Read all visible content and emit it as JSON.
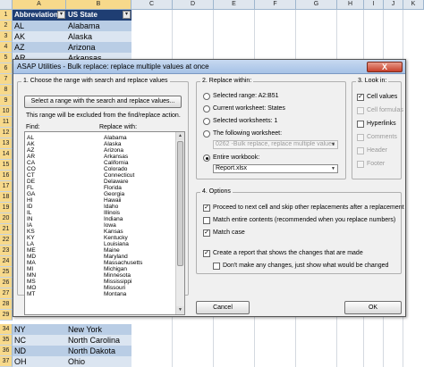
{
  "spreadsheet": {
    "columns": [
      "A",
      "B",
      "C",
      "D",
      "E",
      "F",
      "G",
      "H",
      "I",
      "J",
      "K"
    ],
    "selected_columns": [
      "A",
      "B"
    ],
    "header_row": {
      "a": "Abbreviation",
      "b": "US State"
    },
    "top_rows": [
      {
        "row": "1"
      },
      {
        "row": "2",
        "a": "AL",
        "b": "Alabama"
      },
      {
        "row": "3",
        "a": "AK",
        "b": "Alaska"
      },
      {
        "row": "4",
        "a": "AZ",
        "b": "Arizona"
      },
      {
        "row": "5",
        "a": "AR",
        "b": "Arkansas"
      }
    ],
    "hidden_rows": [
      "6",
      "7",
      "8",
      "9",
      "10",
      "11",
      "12",
      "13",
      "14",
      "15",
      "16",
      "17",
      "18",
      "19",
      "20",
      "21",
      "22",
      "23",
      "24",
      "25",
      "26",
      "27",
      "28",
      "29",
      "30",
      "31",
      "32",
      "33"
    ],
    "bottom_rows": [
      {
        "row": "34",
        "a": "NY",
        "b": "New York"
      },
      {
        "row": "35",
        "a": "NC",
        "b": "North Carolina"
      },
      {
        "row": "36",
        "a": "ND",
        "b": "North Dakota"
      },
      {
        "row": "37",
        "a": "OH",
        "b": "Ohio"
      }
    ],
    "filter_glyph": "▾"
  },
  "dialog": {
    "title": "ASAP Utilities - Bulk replace: replace multiple values at once",
    "close_glyph": "X",
    "group1": {
      "label": "1. Choose the range with search and replace values",
      "select_button": "Select a range with the search and replace values...",
      "note": "This range will be excluded from the find/replace action.",
      "find_header": "Find:",
      "replace_header": "Replace with:",
      "pairs": [
        [
          "AL",
          "Alabama"
        ],
        [
          "AK",
          "Alaska"
        ],
        [
          "AZ",
          "Arizona"
        ],
        [
          "AR",
          "Arkansas"
        ],
        [
          "CA",
          "California"
        ],
        [
          "CO",
          "Colorado"
        ],
        [
          "CT",
          "Connecticut"
        ],
        [
          "DE",
          "Delaware"
        ],
        [
          "FL",
          "Florida"
        ],
        [
          "GA",
          "Georgia"
        ],
        [
          "HI",
          "Hawaii"
        ],
        [
          "ID",
          "Idaho"
        ],
        [
          "IL",
          "Illinois"
        ],
        [
          "IN",
          "Indiana"
        ],
        [
          "IA",
          "Iowa"
        ],
        [
          "KS",
          "Kansas"
        ],
        [
          "KY",
          "Kentucky"
        ],
        [
          "LA",
          "Louisiana"
        ],
        [
          "ME",
          "Maine"
        ],
        [
          "MD",
          "Maryland"
        ],
        [
          "MA",
          "Massachusetts"
        ],
        [
          "MI",
          "Michigan"
        ],
        [
          "MN",
          "Minnesota"
        ],
        [
          "MS",
          "Mississippi"
        ],
        [
          "MO",
          "Missouri"
        ],
        [
          "MT",
          "Montana"
        ]
      ]
    },
    "group2": {
      "label": "2. Replace within:",
      "opt_selected_range": "Selected range: A2:B51",
      "opt_current_ws": "Current worksheet: States",
      "opt_selected_ws": "Selected worksheets: 1",
      "opt_following_ws": "The following worksheet:",
      "following_ws_value": "0262 -Bulk replace, replace multiple values",
      "opt_entire_workbook": "Entire workbook:",
      "workbook_value": "Report.xlsx"
    },
    "group3": {
      "label": "3. Look in:",
      "cell_values": "Cell values",
      "cell_formulas": "Cell formulas",
      "hyperlinks": "Hyperlinks",
      "comments": "Comments",
      "header": "Header",
      "footer": "Footer"
    },
    "group4": {
      "label": "4. Options",
      "proceed": "Proceed to next cell and skip other replacements after a replacement",
      "match_entire": "Match entire contents (recommended when you replace numbers)",
      "match_case": "Match case",
      "create_report": "Create a report that shows the changes that are made",
      "dont_make_changes": "Don't make any changes, just show what would be changed"
    },
    "cancel": "Cancel",
    "ok": "OK",
    "check_glyph": "✓",
    "dropdown_glyph": "▼"
  },
  "colors": {
    "header_fill": "#1f3e73",
    "band_fill": "#b9cde5"
  }
}
